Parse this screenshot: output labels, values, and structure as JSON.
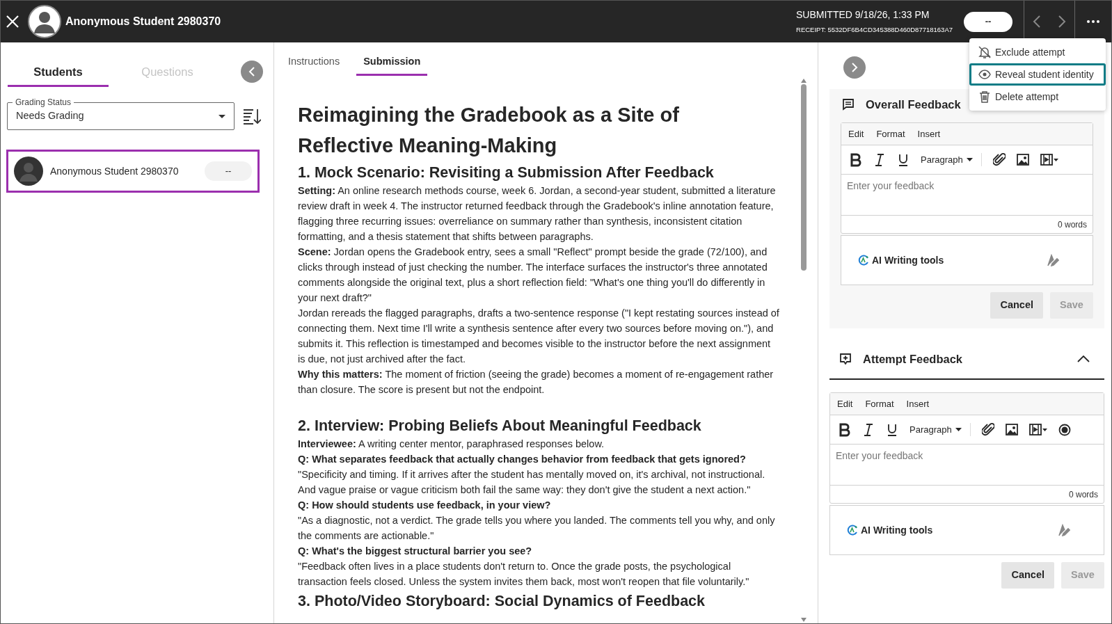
{
  "header": {
    "title": "Anonymous Student 2980370",
    "submitted": "SUBMITTED 9/18/26, 1:33 PM",
    "receipt": "RECEIPT: 5532DF6B4CD345388D460D87718163A7",
    "grade": "--"
  },
  "menu": [
    {
      "kind": "exclude",
      "label": "Exclude attempt",
      "selected": false
    },
    {
      "kind": "reveal",
      "label": "Reveal student identity",
      "selected": true
    },
    {
      "kind": "delete",
      "label": "Delete attempt",
      "selected": false
    }
  ],
  "left": {
    "tabs": [
      {
        "label": "Students",
        "selected": true
      },
      {
        "label": "Questions",
        "selected": false
      }
    ],
    "filter": {
      "label": "Grading Status",
      "value": "Needs Grading"
    },
    "students": [
      {
        "name": "Anonymous Student 2980370",
        "grade": "--",
        "selected": true
      }
    ]
  },
  "middle": {
    "tabs": [
      {
        "label": "Instructions",
        "selected": false
      },
      {
        "label": "Submission",
        "selected": true
      }
    ],
    "blocks": [
      {
        "kind": "h1",
        "text": "Reimagining the Gradebook as a Site of Reflective Meaning-Making"
      },
      {
        "kind": "h2",
        "text": "1. Mock Scenario: Revisiting a Submission After Feedback"
      },
      {
        "kind": "p",
        "text": "**Setting:** An online research methods course, week 6. Jordan, a second-year student, submitted a literature review draft in week 4. The instructor returned feedback through the Gradebook's inline annotation feature, flagging three recurring issues: overreliance on summary rather than synthesis, inconsistent citation formatting, and a thesis statement that shifts between paragraphs."
      },
      {
        "kind": "p",
        "text": "**Scene:** Jordan opens the Gradebook entry, sees a small \"Reflect\" prompt beside the grade (72/100), and clicks through instead of just checking the number. The interface surfaces the instructor's three annotated comments alongside the original text, plus a short reflection field: \"What's one thing you'll do differently in your next draft?\""
      },
      {
        "kind": "p",
        "text": "Jordan rereads the flagged paragraphs, drafts a two-sentence response (\"I kept restating sources instead of connecting them. Next time I'll write a synthesis sentence after every two sources before moving on.\"), and submits it. This reflection is timestamped and becomes visible to the instructor before the next assignment is due, not just archived after the fact."
      },
      {
        "kind": "p",
        "text": "**Why this matters:** The moment of friction (seeing the grade) becomes a moment of re-engagement rather than closure. The score is present but not the endpoint."
      },
      {
        "kind": "h2",
        "text": "2. Interview: Probing Beliefs About Meaningful Feedback"
      },
      {
        "kind": "p",
        "text": "**Interviewee:** A writing center mentor, paraphrased responses below."
      },
      {
        "kind": "q",
        "text": "Q: What separates feedback that actually changes behavior from feedback that gets ignored?"
      },
      {
        "kind": "p",
        "text": "\"Specificity and timing. If it arrives after the student has mentally moved on, it's archival, not instructional. And vague praise or vague criticism both fail the same way: they don't give the student a next action.\""
      },
      {
        "kind": "q",
        "text": "Q: How should students use feedback, in your view?"
      },
      {
        "kind": "p",
        "text": "\"As a diagnostic, not a verdict. The grade tells you where you landed. The comments tell you why, and only the comments are actionable.\""
      },
      {
        "kind": "q",
        "text": "Q: What's the biggest structural barrier you see?"
      },
      {
        "kind": "p",
        "text": "\"Feedback often lives in a place students don't return to. Once the grade posts, the psychological transaction feels closed. Unless the system invites them back, most won't reopen that file voluntarily.\""
      },
      {
        "kind": "h2",
        "text": "3. Photo/Video Storyboard: Social Dynamics of Feedback"
      }
    ]
  },
  "editors": [
    {
      "kind": "overall",
      "title": "Overall Feedback",
      "menus": [
        "Edit",
        "Format",
        "Insert"
      ],
      "toolbar": [
        {
          "kind": "bold"
        },
        {
          "kind": "italic"
        },
        {
          "kind": "underline"
        },
        {
          "kind": "paragraph",
          "label": "Paragraph"
        },
        {
          "kind": "attach"
        },
        {
          "kind": "image"
        },
        {
          "kind": "media"
        }
      ],
      "placeholder": "Enter your feedback",
      "word_count": "0 words",
      "ai_label": "AI Writing tools",
      "buttons": [
        {
          "label": "Cancel",
          "disabled": false
        },
        {
          "label": "Save",
          "disabled": true
        }
      ]
    },
    {
      "kind": "attempt",
      "title": "Attempt Feedback",
      "expanded": true,
      "menus": [
        "Edit",
        "Format",
        "Insert"
      ],
      "toolbar": [
        {
          "kind": "bold"
        },
        {
          "kind": "italic"
        },
        {
          "kind": "underline"
        },
        {
          "kind": "paragraph",
          "label": "Paragraph"
        },
        {
          "kind": "attach"
        },
        {
          "kind": "image"
        },
        {
          "kind": "media"
        },
        {
          "kind": "record"
        }
      ],
      "placeholder": "Enter your feedback",
      "word_count": "0 words",
      "ai_label": "AI Writing tools",
      "buttons": [
        {
          "label": "Cancel",
          "disabled": false
        },
        {
          "label": "Save",
          "disabled": true
        }
      ]
    }
  ]
}
